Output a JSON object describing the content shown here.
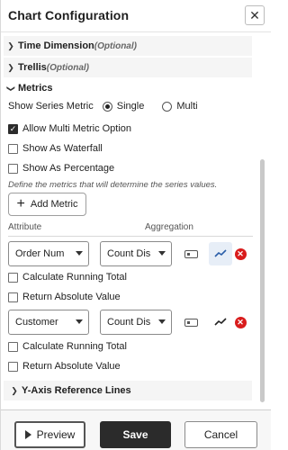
{
  "header": {
    "title": "Chart Configuration",
    "close_icon": "close-icon"
  },
  "sections": {
    "time_dimension": {
      "label": "Time Dimension",
      "optional": "(Optional)",
      "expanded": false
    },
    "trellis": {
      "label": "Trellis",
      "optional": "(Optional)",
      "expanded": false
    },
    "metrics": {
      "label": "Metrics",
      "expanded": true
    },
    "y_axis": {
      "label": "Y-Axis Reference Lines",
      "expanded": false
    }
  },
  "metrics": {
    "series_metric_label": "Show Series Metric",
    "series_options": [
      {
        "label": "Single",
        "selected": true
      },
      {
        "label": "Multi",
        "selected": false
      }
    ],
    "allow_multi": {
      "label": "Allow Multi Metric Option",
      "checked": true
    },
    "waterfall": {
      "label": "Show As Waterfall",
      "checked": false
    },
    "percentage": {
      "label": "Show As Percentage",
      "checked": false
    },
    "hint": "Define the metrics that will determine the series values.",
    "add_metric_label": "Add Metric",
    "attribute_header": "Attribute",
    "aggregation_header": "Aggregation",
    "rows": [
      {
        "attribute": "Order Num",
        "aggregation": "Count Dis",
        "trend_active": true,
        "running_total": {
          "label": "Calculate Running Total",
          "checked": false
        },
        "absolute": {
          "label": "Return Absolute Value",
          "checked": false
        }
      },
      {
        "attribute": "Customer",
        "aggregation": "Count Dis",
        "trend_active": false,
        "running_total": {
          "label": "Calculate Running Total",
          "checked": false
        },
        "absolute": {
          "label": "Return Absolute Value",
          "checked": false
        }
      }
    ]
  },
  "footer": {
    "preview_label": "Preview",
    "save_label": "Save",
    "cancel_label": "Cancel"
  },
  "colors": {
    "accent": "#2b2b2b",
    "delete": "#d91c1c",
    "trend_active_bg": "#e7eef7",
    "trend_active_line": "#2a5ea8"
  }
}
